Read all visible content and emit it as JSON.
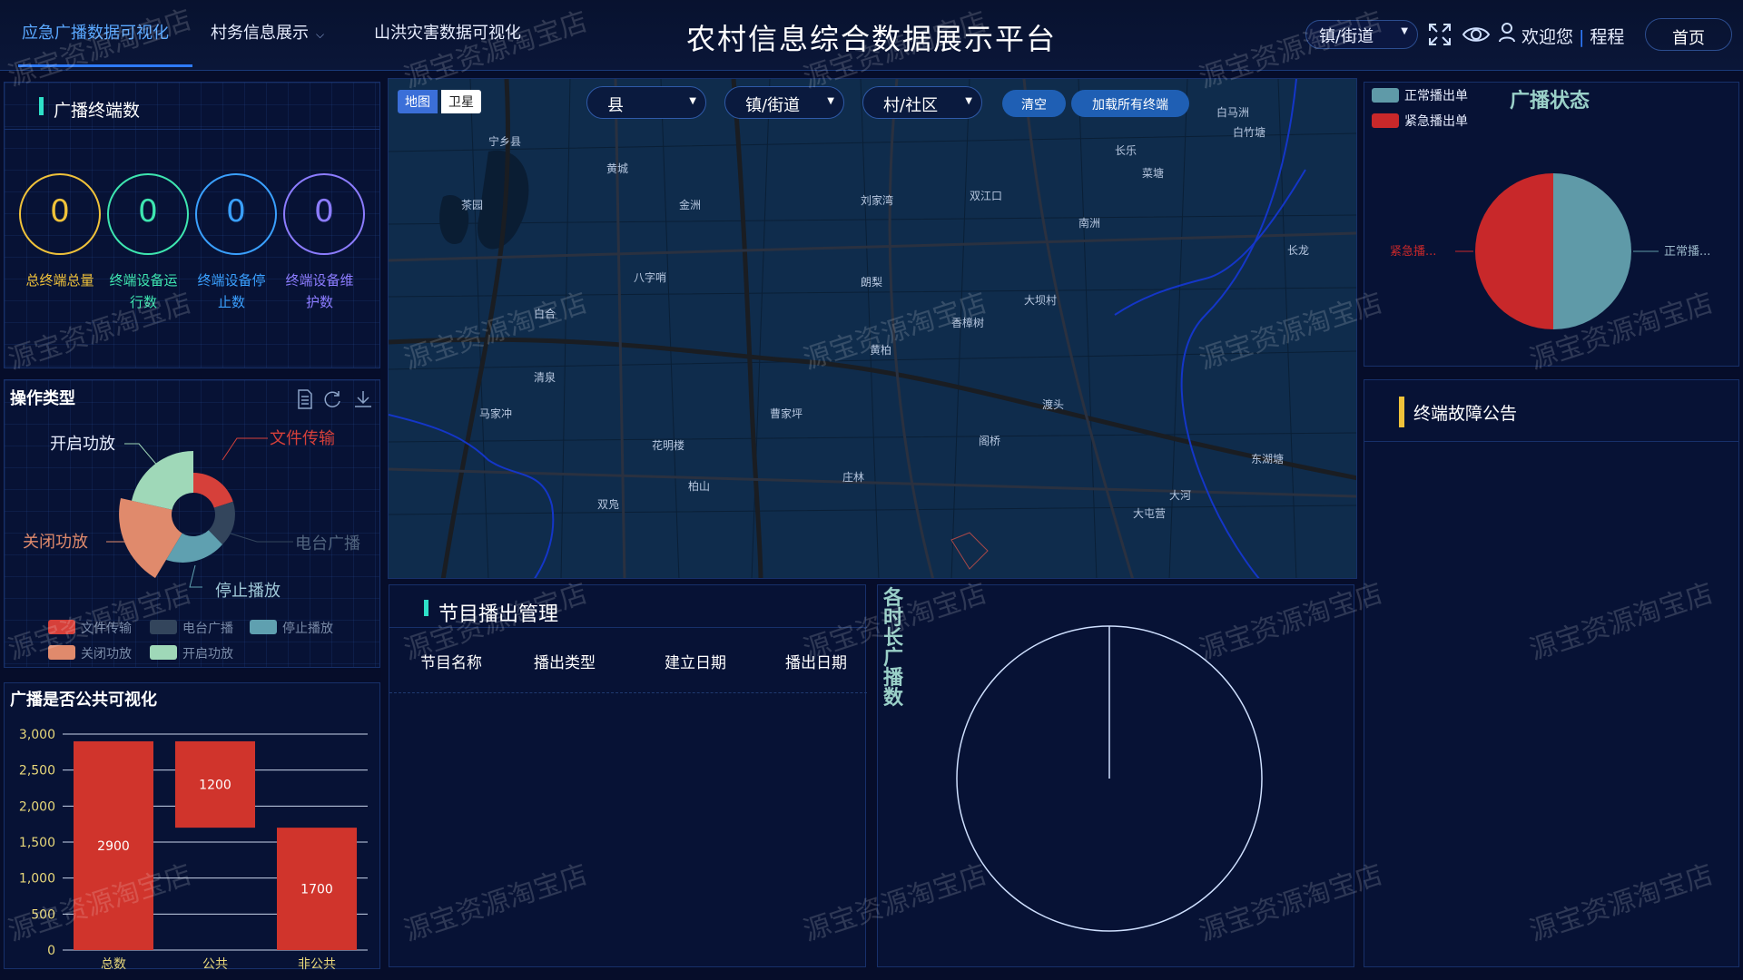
{
  "header": {
    "tabs": [
      {
        "label": "应急广播数据可视化",
        "active": true
      },
      {
        "label": "村务信息展示",
        "active": false
      },
      {
        "label": "山洪灾害数据可视化",
        "active": false
      }
    ],
    "title": "农村信息综合数据展示平台",
    "town_select": "镇/街道",
    "welcome": "欢迎您",
    "user": "程程",
    "home": "首页"
  },
  "terminals": {
    "title": "广播终端数",
    "items": [
      {
        "value": "0",
        "label": "总终端总量",
        "color": "#f0c23a"
      },
      {
        "value": "0",
        "label": "终端设备运行数",
        "color": "#3ee6b0"
      },
      {
        "value": "0",
        "label": "终端设备停止数",
        "color": "#3aa0ff"
      },
      {
        "value": "0",
        "label": "终端设备维护数",
        "color": "#8c7cff"
      }
    ]
  },
  "operation": {
    "title": "操作类型",
    "labels": {
      "open": "开启功放",
      "file": "文件传输",
      "close": "关闭功放",
      "radio": "电台广播",
      "stop": "停止播放"
    },
    "legend": [
      {
        "name": "文件传输",
        "color": "#d6403a"
      },
      {
        "name": "电台广播",
        "color": "#33455c"
      },
      {
        "name": "停止播放",
        "color": "#5fa0b0"
      },
      {
        "name": "关闭功放",
        "color": "#e08a6c"
      },
      {
        "name": "开启功放",
        "color": "#9fd8b8"
      }
    ]
  },
  "public_chart": {
    "title": "广播是否公共可视化",
    "chart_data": {
      "type": "bar",
      "categories": [
        "总数",
        "公共",
        "非公共"
      ],
      "values": [
        2900,
        1200,
        1700
      ],
      "ylim": [
        0,
        3000
      ],
      "yticks": [
        "0",
        "500",
        "1,000",
        "1,500",
        "2,000",
        "2,500",
        "3,000"
      ],
      "color": "#d0342c"
    }
  },
  "map": {
    "toggle": [
      "地图",
      "卫星"
    ],
    "selects": [
      "县",
      "镇/街道",
      "村/社区"
    ],
    "buttons": [
      "清空",
      "加载所有终端"
    ],
    "places": [
      "宁乡县",
      "白马洲",
      "白竹塘",
      "长乐",
      "菜塘",
      "茶园",
      "黄城",
      "金洲",
      "刘家湾",
      "双江口",
      "南洲",
      "曹家坪",
      "阁桥",
      "白合",
      "八字哨",
      "大坝村",
      "朗梨",
      "香樟树",
      "花明楼",
      "双凫",
      "大屯营",
      "渡头",
      "长龙",
      "东湖塘",
      "马家冲",
      "黄柏",
      "庄林",
      "大河",
      "柏山",
      "清泉"
    ]
  },
  "program": {
    "title": "节目播出管理",
    "columns": [
      "节目名称",
      "播出类型",
      "建立日期",
      "播出日期"
    ]
  },
  "duration": {
    "title": "各时长广播数"
  },
  "status": {
    "title": "广播状态",
    "legend": [
      {
        "name": "正常播出单",
        "color": "#5f9aa8"
      },
      {
        "name": "紧急播出单",
        "color": "#c8282a"
      }
    ],
    "slice_labels": [
      "紧急播...",
      "正常播..."
    ],
    "chart_data": {
      "type": "pie",
      "categories": [
        "正常播出单",
        "紧急播出单"
      ],
      "values": [
        50,
        50
      ]
    }
  },
  "fault": {
    "title": "终端故障公告"
  },
  "watermark": "源宝资源淘宝店"
}
